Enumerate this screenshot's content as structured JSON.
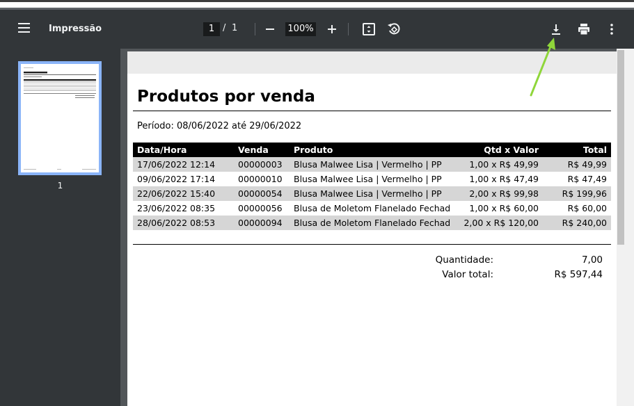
{
  "toolbar": {
    "title": "Impressão",
    "page_current": "1",
    "page_separator": "/",
    "page_total": "1",
    "zoom": "100%"
  },
  "sidebar": {
    "thumbnail_page_number": "1"
  },
  "report": {
    "title": "Produtos por venda",
    "period": "Período: 08/06/2022 até 29/06/2022",
    "columns": [
      "Data/Hora",
      "Venda",
      "Produto",
      "Qtd x Valor",
      "Total"
    ],
    "rows": [
      [
        "17/06/2022 12:14",
        "00000003",
        "Blusa Malwee Lisa | Vermelho | PP",
        "1,00 x R$ 49,99",
        "R$ 49,99"
      ],
      [
        "09/06/2022 17:14",
        "00000010",
        "Blusa Malwee Lisa | Vermelho | PP",
        "1,00 x R$ 47,49",
        "R$ 47,49"
      ],
      [
        "22/06/2022 15:40",
        "00000054",
        "Blusa Malwee Lisa | Vermelho | PP",
        "2,00 x R$ 99,98",
        "R$ 199,96"
      ],
      [
        "23/06/2022 08:35",
        "00000056",
        "Blusa de Moletom Flanelado Fechado |",
        "1,00 x R$ 60,00",
        "R$ 60,00"
      ],
      [
        "28/06/2022 08:53",
        "00000094",
        "Blusa de Moletom Flanelado Fechado |",
        "2,00 x R$ 120,00",
        "R$ 240,00"
      ]
    ],
    "summary": {
      "quantity_label": "Quantidade:",
      "quantity_value": "7,00",
      "total_label": "Valor total:",
      "total_value": "R$ 597,44"
    }
  },
  "colors": {
    "toolbar_bg": "#323639",
    "viewer_bg": "#525659",
    "thumb_border": "#8ab4f8",
    "annotation_arrow": "#8fd63a"
  }
}
